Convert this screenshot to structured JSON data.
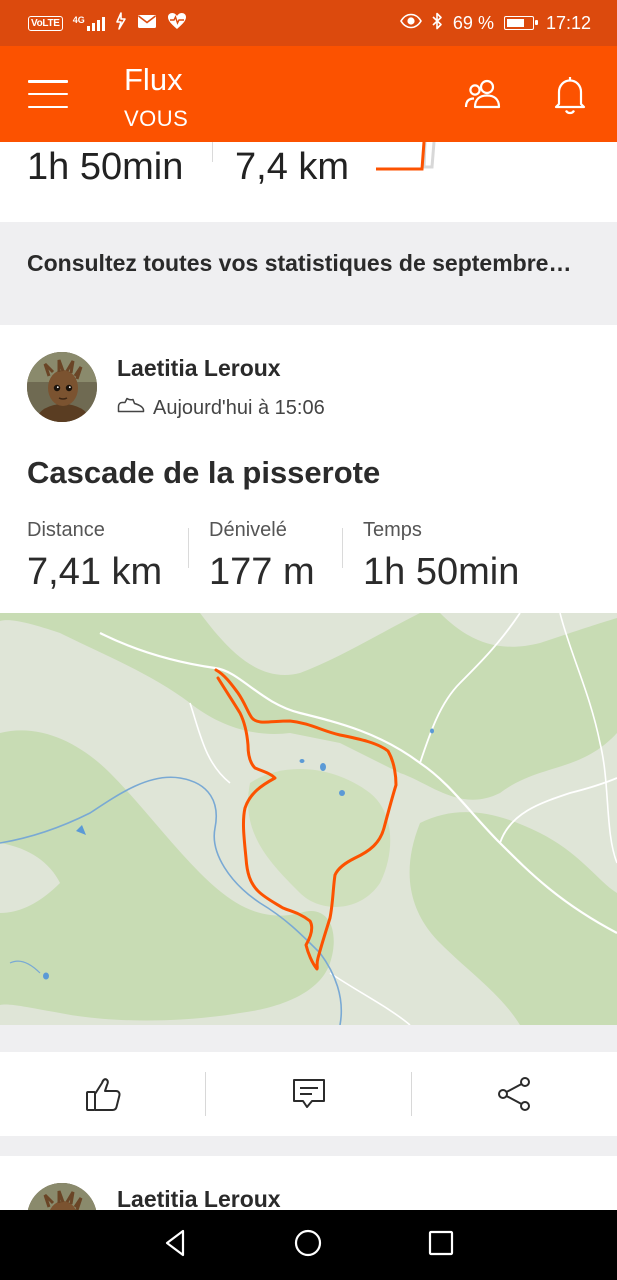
{
  "status_bar": {
    "network": "VoLTE",
    "network_gen": "4G",
    "battery_percent": "69 %",
    "battery_level": 0.69,
    "time": "17:12",
    "icons": [
      "volte-icon",
      "signal-icon",
      "data-icon",
      "mail-icon",
      "health-icon",
      "eye-icon",
      "bluetooth-icon",
      "battery-icon"
    ]
  },
  "app_bar": {
    "title": "Flux",
    "subtitle": "VOUS",
    "icons": [
      "menu-icon",
      "friends-icon",
      "bell-icon"
    ]
  },
  "previous_card": {
    "duration": "1h 50min",
    "distance": "7,4 km"
  },
  "stats_banner": "Consultez toutes vos statistiques de septembre…",
  "activity": {
    "athlete": "Laetitia Leroux",
    "timestamp": "Aujourd'hui à 15:06",
    "type_icon": "hiking-shoe-icon",
    "title": "Cascade de la pisserote",
    "stats": [
      {
        "label": "Distance",
        "value": "7,41 km"
      },
      {
        "label": "Dénivelé",
        "value": "177 m"
      },
      {
        "label": "Temps",
        "value": "1h 50min"
      }
    ],
    "route_color": "#fc5200"
  },
  "actions": [
    "like-icon",
    "comment-icon",
    "share-icon"
  ],
  "next_card": {
    "athlete": "Laetitia Leroux"
  },
  "nav_bar": [
    "back-icon",
    "home-icon",
    "recents-icon"
  ],
  "colors": {
    "brand": "#fc5200",
    "status_bar": "#dc4a0d",
    "background": "#efeff1"
  }
}
